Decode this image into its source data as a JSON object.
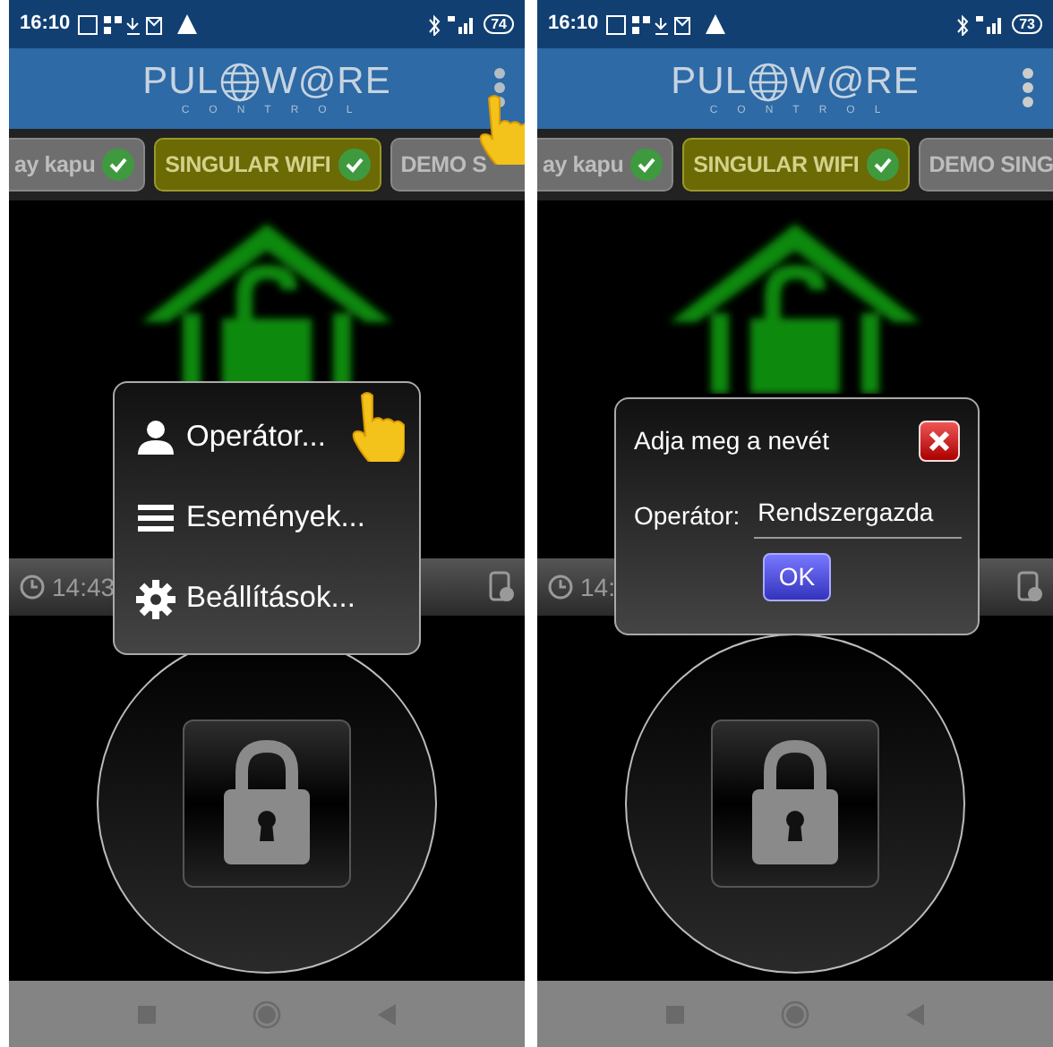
{
  "screens": [
    {
      "status_bar": {
        "time": "16:10",
        "battery": "74"
      },
      "logo": {
        "left": "PUL",
        "right": "W@RE",
        "subtitle": "CONTROL"
      },
      "overflow_tapped": true,
      "tabs": [
        {
          "label": "ay kapu",
          "selected": false,
          "checked": true
        },
        {
          "label": "SINGULAR WIFI",
          "selected": true,
          "checked": true
        },
        {
          "label": "DEMO S",
          "selected": false,
          "checked": false
        }
      ],
      "clock_time": "14:43",
      "overlay": {
        "kind": "menu",
        "items": [
          {
            "label": "Operátor...",
            "tapped": true
          },
          {
            "label": "Események...",
            "tapped": false
          },
          {
            "label": "Beállítások...",
            "tapped": false
          }
        ]
      }
    },
    {
      "status_bar": {
        "time": "16:10",
        "battery": "73"
      },
      "logo": {
        "left": "PUL",
        "right": "W@RE",
        "subtitle": "CONTROL"
      },
      "overflow_tapped": false,
      "tabs": [
        {
          "label": "ay kapu",
          "selected": false,
          "checked": true
        },
        {
          "label": "SINGULAR WIFI",
          "selected": true,
          "checked": true
        },
        {
          "label": "DEMO SING",
          "selected": false,
          "checked": false
        }
      ],
      "clock_time": "14:",
      "overlay": {
        "kind": "dialog",
        "title": "Adja meg a nevét",
        "field_label": "Operátor:",
        "value": "Rendszergazda",
        "button": "OK"
      }
    }
  ]
}
